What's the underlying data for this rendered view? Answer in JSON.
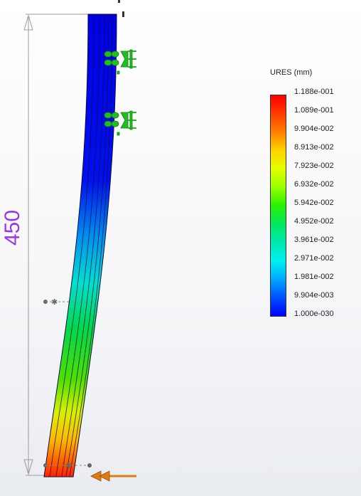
{
  "legend": {
    "title": "URES (mm)",
    "entries": [
      {
        "label": "1.188e-001",
        "color": "#ff0000"
      },
      {
        "label": "1.089e-001",
        "color": "#ff3c00"
      },
      {
        "label": "9.904e-002",
        "color": "#ff8000"
      },
      {
        "label": "8.913e-002",
        "color": "#ffd200"
      },
      {
        "label": "7.923e-002",
        "color": "#e4ff00"
      },
      {
        "label": "6.932e-002",
        "color": "#98ff00"
      },
      {
        "label": "5.942e-002",
        "color": "#28f000"
      },
      {
        "label": "4.952e-002",
        "color": "#00e860"
      },
      {
        "label": "3.961e-002",
        "color": "#00e8b0"
      },
      {
        "label": "2.971e-002",
        "color": "#00f0f0"
      },
      {
        "label": "1.981e-002",
        "color": "#00a8ff"
      },
      {
        "label": "9.904e-003",
        "color": "#0050ff"
      },
      {
        "label": "1.000e-030",
        "color": "#0000ff"
      }
    ]
  },
  "dimension": {
    "value": "450",
    "color": "#9a34e8"
  },
  "colors": {
    "fixture": "#1fbf1f",
    "load_arrow": "#e07b10",
    "dimension_line": "#8c8c8c"
  },
  "icons": {
    "fixture": "fixed-geometry-icon",
    "load": "force-arrow-icon"
  }
}
